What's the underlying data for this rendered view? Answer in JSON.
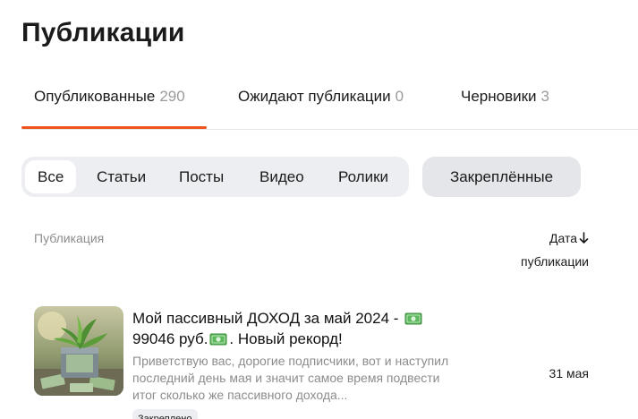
{
  "page": {
    "title": "Публикации"
  },
  "tabs": [
    {
      "label": "Опубликованные",
      "count": "290",
      "active": true
    },
    {
      "label": "Ожидают публикации",
      "count": "0",
      "active": false
    },
    {
      "label": "Черновики",
      "count": "3",
      "active": false
    }
  ],
  "filters": {
    "chips": [
      "Все",
      "Статьи",
      "Посты",
      "Видео",
      "Ролики"
    ],
    "active": "Все",
    "pinned_label": "Закреплённые"
  },
  "table": {
    "col_publication": "Публикация",
    "col_date_line1": "Дата",
    "col_date_line2": "публикации",
    "sort_icon": "arrow-down-icon"
  },
  "publication": {
    "title_part1": "Мой пассивный ДОХОД за май 2024 -",
    "title_part2": "99046 руб.",
    "title_part3": ". Новый рекорд!",
    "title_icon": "money-icon",
    "snippet": "Приветствую вас, дорогие подписчики, вот и наступил последний день мая и значит самое время подвести итог сколько же пассивного дохода...",
    "date": "31 мая",
    "badge": "Закреплено"
  },
  "colors": {
    "accent": "#f0541e",
    "chip_bg": "#eceef1",
    "muted_text": "#8c8c8c"
  }
}
